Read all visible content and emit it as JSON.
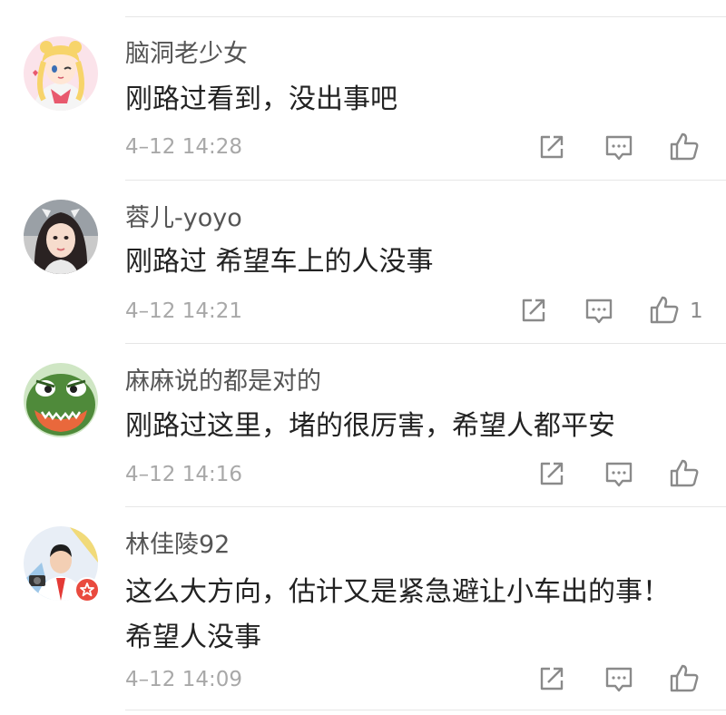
{
  "comments": [
    {
      "username": "脑洞老少女",
      "text": "刚路过看到，没出事吧",
      "time": "4–12 14:28",
      "likes": "",
      "avatar": "anime-girl-avatar"
    },
    {
      "username": "蓉儿-yoyo",
      "text": "刚路过 希望车上的人没事",
      "time": "4–12 14:21",
      "likes": "1",
      "avatar": "woman-selfie-avatar"
    },
    {
      "username": "麻麻说的都是对的",
      "text": "刚路过这里，堵的很厉害，希望人都平安",
      "time": "4–12 14:16",
      "likes": "",
      "avatar": "green-frog-avatar"
    },
    {
      "username": "林佳陵92",
      "text": "这么大方向，估计又是紧急避让小车出的事！希望人没事",
      "time": "4–12 14:09",
      "likes": "",
      "avatar": "man-photo-avatar",
      "badge": "verified-badge-icon"
    }
  ],
  "colors": {
    "username": "#555555",
    "text": "#222222",
    "time": "#a8a8a8",
    "icon": "#8a8a8a",
    "divider": "#e6e6e6",
    "badge": "#e94a3e"
  }
}
